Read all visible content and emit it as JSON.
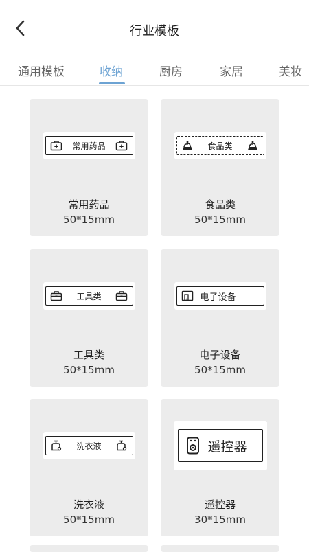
{
  "header": {
    "title": "行业模板"
  },
  "tabs": [
    {
      "label": "通用模板",
      "active": false
    },
    {
      "label": "收纳",
      "active": true
    },
    {
      "label": "厨房",
      "active": false
    },
    {
      "label": "家居",
      "active": false
    },
    {
      "label": "美妆",
      "active": false
    }
  ],
  "accent_color": "#6da3d3",
  "templates": [
    {
      "name": "常用药品",
      "size": "50*15mm",
      "label_text": "常用药品",
      "icon": "first-aid-kit-icon"
    },
    {
      "name": "食品类",
      "size": "50*15mm",
      "label_text": "食品类",
      "icon": "dessert-icon"
    },
    {
      "name": "工具类",
      "size": "50*15mm",
      "label_text": "工具类",
      "icon": "toolbox-icon"
    },
    {
      "name": "电子设备",
      "size": "50*15mm",
      "label_text": "电子设备",
      "icon": "phone-tablet-icon"
    },
    {
      "name": "洗衣液",
      "size": "50*15mm",
      "label_text": "洗衣液",
      "icon": "detergent-bottle-icon"
    },
    {
      "name": "遥控器",
      "size": "30*15mm",
      "label_text": "遥控器",
      "icon": "remote-control-icon"
    }
  ]
}
